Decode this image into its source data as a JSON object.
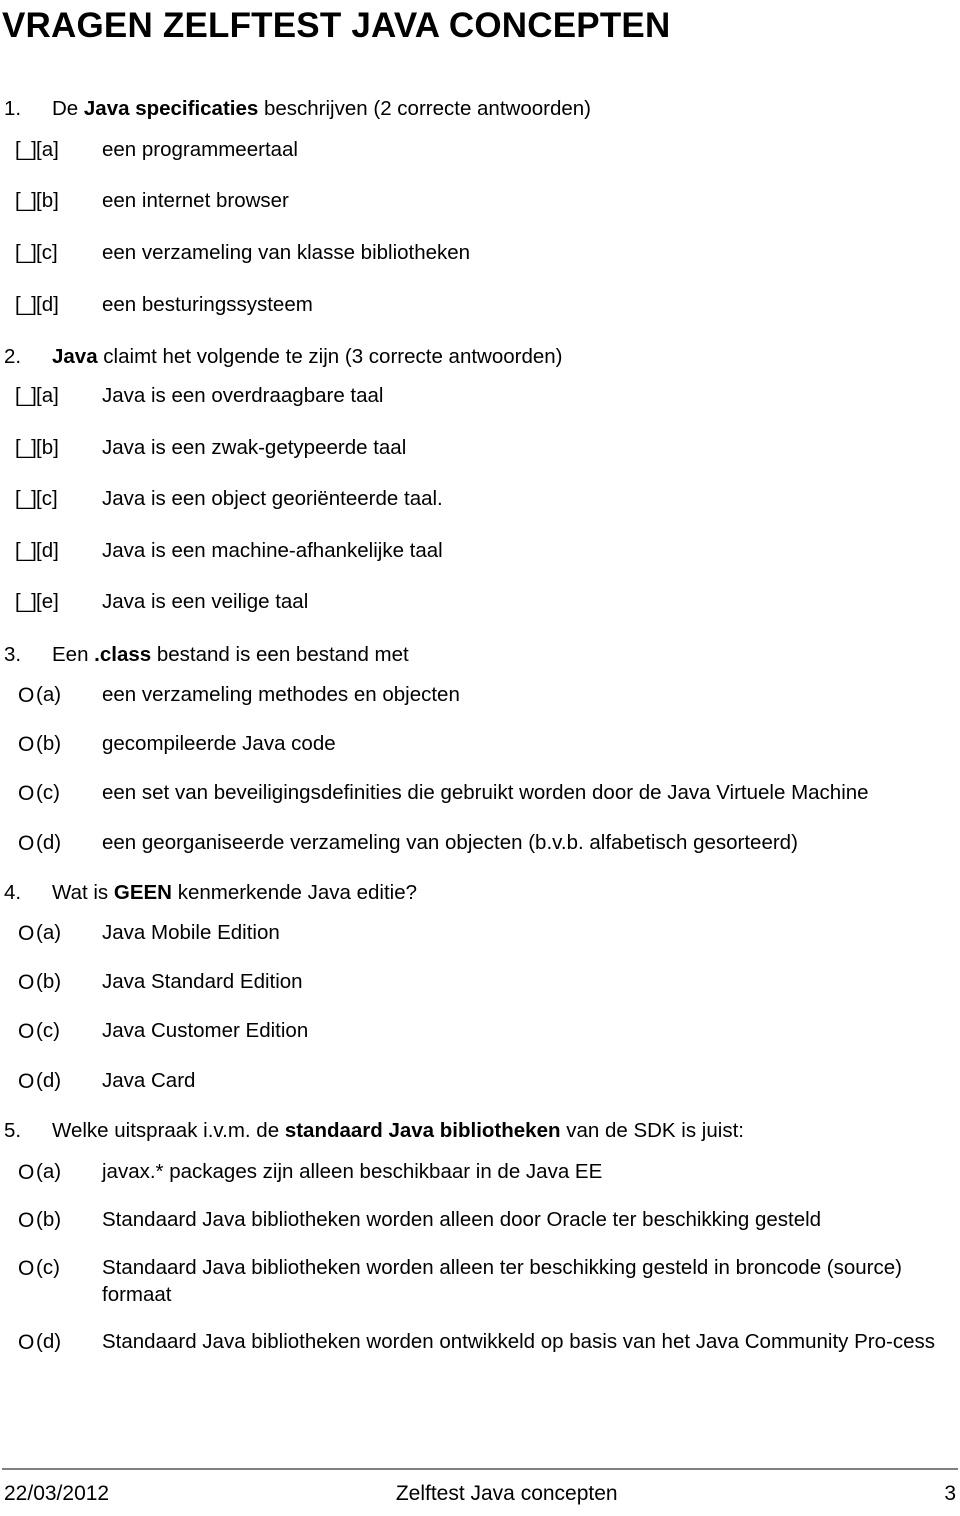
{
  "document": {
    "title": "VRAGEN ZELFTEST JAVA CONCEPTEN"
  },
  "questions": [
    {
      "number": "1.",
      "heading_prefix": "De ",
      "heading_bold": "Java specificaties",
      "heading_suffix": " beschrijven (2 correcte antwoorden)",
      "marker_type": "checkbox",
      "marker_glyph": "[_]",
      "options": [
        {
          "label": "[a]",
          "text": "een programmeertaal"
        },
        {
          "label": "[b]",
          "text": "een internet browser"
        },
        {
          "label": "[c]",
          "text": "een verzameling van klasse bibliotheken"
        },
        {
          "label": "[d]",
          "text": "een besturingssysteem"
        }
      ]
    },
    {
      "number": "2.",
      "heading_prefix": "",
      "heading_bold": "Java",
      "heading_suffix": " claimt het volgende te zijn (3 correcte antwoorden)",
      "marker_type": "checkbox",
      "marker_glyph": "[_]",
      "options": [
        {
          "label": "[a]",
          "text": "Java is een overdraagbare taal"
        },
        {
          "label": "[b]",
          "text": "Java is een zwak-getypeerde taal"
        },
        {
          "label": "[c]",
          "text": "Java is een object georiënteerde taal."
        },
        {
          "label": "[d]",
          "text": "Java is een machine-afhankelijke taal"
        },
        {
          "label": "[e]",
          "text": "Java is een veilige taal"
        }
      ]
    },
    {
      "number": "3.",
      "heading_prefix": "Een ",
      "heading_bold": ".class",
      "heading_suffix": " bestand is een bestand met",
      "marker_type": "radio",
      "marker_glyph": "O",
      "options": [
        {
          "label": "(a)",
          "text": "een verzameling methodes en objecten"
        },
        {
          "label": "(b)",
          "text": "gecompileerde Java code"
        },
        {
          "label": "(c)",
          "text": "een set van beveiligingsdefinities die gebruikt worden door de Java Virtuele Machine"
        },
        {
          "label": "(d)",
          "text": "een georganiseerde verzameling van objecten (b.v.b. alfabetisch gesorteerd)"
        }
      ]
    },
    {
      "number": "4.",
      "heading_prefix": "Wat is ",
      "heading_bold": "GEEN",
      "heading_suffix": " kenmerkende Java editie?",
      "marker_type": "radio",
      "marker_glyph": "O",
      "options": [
        {
          "label": "(a)",
          "text": "Java Mobile Edition"
        },
        {
          "label": "(b)",
          "text": "Java Standard Edition"
        },
        {
          "label": "(c)",
          "text": "Java Customer Edition"
        },
        {
          "label": "(d)",
          "text": "Java Card"
        }
      ]
    },
    {
      "number": "5.",
      "heading_prefix": "Welke uitspraak i.v.m. de ",
      "heading_bold": "standaard Java bibliotheken",
      "heading_suffix": " van de SDK is juist:",
      "marker_type": "radio",
      "marker_glyph": "O",
      "options": [
        {
          "label": "(a)",
          "text": "javax.* packages zijn alleen beschikbaar in de Java EE"
        },
        {
          "label": "(b)",
          "text": "Standaard Java bibliotheken worden alleen door Oracle ter beschikking gesteld"
        },
        {
          "label": "(c)",
          "text": "Standaard Java bibliotheken worden alleen ter beschikking gesteld in broncode (source) formaat"
        },
        {
          "label": "(d)",
          "text": "Standaard Java bibliotheken worden ontwikkeld op basis van het Java Community Pro-cess"
        }
      ]
    }
  ],
  "footer": {
    "date": "22/03/2012",
    "center": "Zelftest Java concepten",
    "page_number": "3"
  }
}
